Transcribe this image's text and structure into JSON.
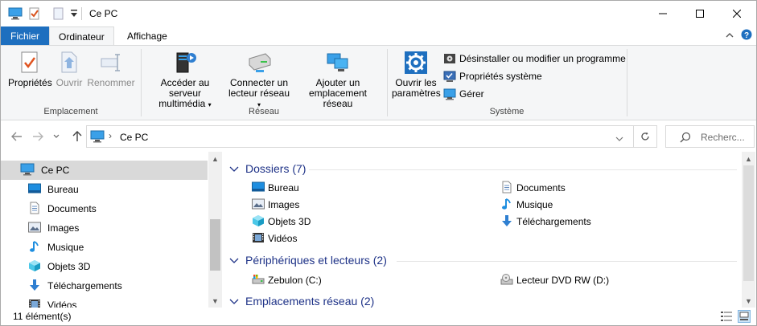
{
  "window": {
    "title": "Ce PC",
    "controls": {
      "minimize": "─",
      "maximize": "☐",
      "close": "✕"
    }
  },
  "tabs": [
    {
      "label": "Fichier"
    },
    {
      "label": "Ordinateur"
    },
    {
      "label": "Affichage"
    }
  ],
  "ribbon": {
    "emplacement": {
      "label": "Emplacement",
      "buttons": [
        {
          "label": "Propriétés",
          "icon": "properties-checkmark-icon",
          "enabled": true
        },
        {
          "label": "Ouvrir",
          "icon": "open-icon",
          "enabled": false
        },
        {
          "label": "Renommer",
          "icon": "rename-icon",
          "enabled": false
        }
      ]
    },
    "reseau": {
      "label": "Réseau",
      "buttons": [
        {
          "line1": "Accéder au serveur",
          "line2": "multimédia",
          "icon": "media-server-icon",
          "has_dropdown": true
        },
        {
          "line1": "Connecter un",
          "line2": "lecteur réseau",
          "icon": "network-drive-icon",
          "has_dropdown": true
        },
        {
          "line1": "Ajouter un",
          "line2": "emplacement réseau",
          "icon": "network-location-icon",
          "has_dropdown": false
        }
      ]
    },
    "systeme": {
      "label": "Système",
      "open_settings": {
        "line1": "Ouvrir les",
        "line2": "paramètres",
        "icon": "gear-icon"
      },
      "small": [
        {
          "label": "Désinstaller ou modifier un programme",
          "icon": "uninstall-icon"
        },
        {
          "label": "Propriétés système",
          "icon": "system-properties-icon"
        },
        {
          "label": "Gérer",
          "icon": "manage-icon"
        }
      ]
    }
  },
  "navbar": {
    "breadcrumb_root": "Ce PC",
    "search_placeholder": "Recherc..."
  },
  "nav_pane": {
    "items": [
      {
        "label": "Ce PC",
        "icon": "computer-icon",
        "selected": true
      },
      {
        "label": "Bureau",
        "icon": "desktop-folder-icon"
      },
      {
        "label": "Documents",
        "icon": "documents-folder-icon"
      },
      {
        "label": "Images",
        "icon": "pictures-folder-icon"
      },
      {
        "label": "Musique",
        "icon": "music-folder-icon"
      },
      {
        "label": "Objets 3D",
        "icon": "3d-objects-folder-icon"
      },
      {
        "label": "Téléchargements",
        "icon": "downloads-folder-icon"
      },
      {
        "label": "Vidéos",
        "icon": "videos-folder-icon"
      }
    ]
  },
  "content": {
    "groups": [
      {
        "title": "Dossiers (7)",
        "left": [
          {
            "label": "Bureau",
            "icon": "desktop-folder-icon"
          },
          {
            "label": "Images",
            "icon": "pictures-folder-icon"
          },
          {
            "label": "Objets 3D",
            "icon": "3d-objects-folder-icon"
          },
          {
            "label": "Vidéos",
            "icon": "videos-folder-icon"
          }
        ],
        "right": [
          {
            "label": "Documents",
            "icon": "documents-folder-icon"
          },
          {
            "label": "Musique",
            "icon": "music-folder-icon"
          },
          {
            "label": "Téléchargements",
            "icon": "downloads-folder-icon"
          }
        ]
      },
      {
        "title": "Périphériques et lecteurs (2)",
        "left": [
          {
            "label": "Zebulon (C:)",
            "icon": "hard-drive-icon"
          }
        ],
        "right": [
          {
            "label": "Lecteur DVD RW (D:)",
            "icon": "dvd-drive-icon"
          }
        ]
      },
      {
        "title": "Emplacements réseau (2)",
        "left": [],
        "right": []
      }
    ]
  },
  "status": {
    "item_count": "11 élément(s)"
  },
  "colors": {
    "file_tab": "#1e6fbf",
    "group_header": "#1e3287",
    "selection": "#d9d9d9"
  }
}
